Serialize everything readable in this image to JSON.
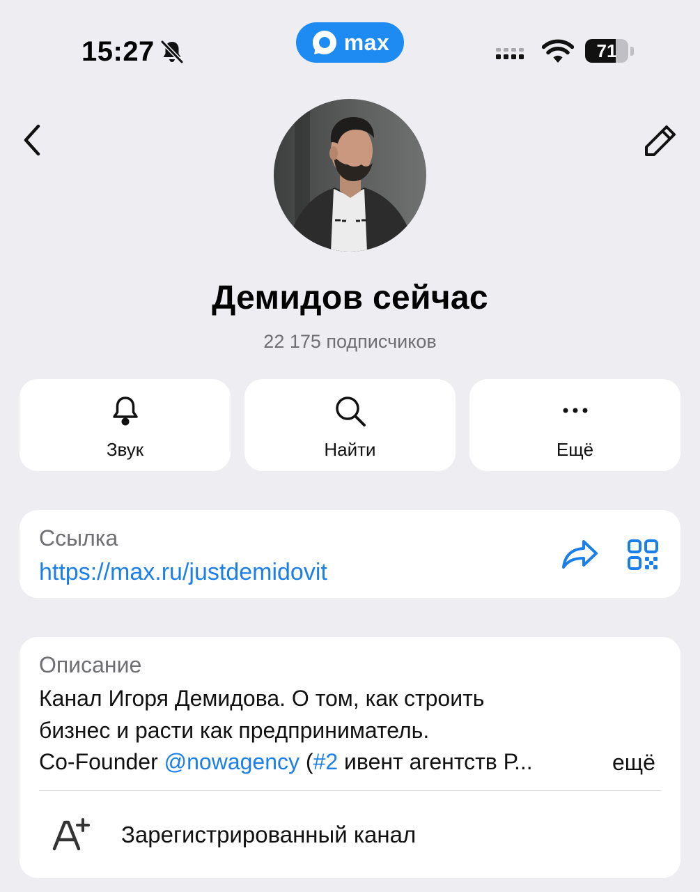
{
  "status_bar": {
    "time": "15:27",
    "battery_level": "71",
    "battery_fraction": 0.71,
    "brand": "max"
  },
  "colors": {
    "background": "#EEEEF2",
    "card": "#FFFFFF",
    "accent": "#1A7FE8",
    "brand": "#1E8BF2",
    "secondary_text": "#6E6E73"
  },
  "icons": {
    "back": "chevron-left-icon",
    "edit": "pencil-icon",
    "sound": "bell-icon",
    "search": "search-icon",
    "more": "ellipsis-icon",
    "share": "share-arrow-icon",
    "qr": "qr-code-icon",
    "registered": "registered-channel-icon"
  },
  "channel": {
    "title": "Демидов сейчас",
    "subscribers": "22 175 подписчиков"
  },
  "actions": [
    {
      "label": "Звук"
    },
    {
      "label": "Найти"
    },
    {
      "label": "Ещё"
    }
  ],
  "link": {
    "caption": "Ссылка",
    "url": "https://max.ru/justdemidovit"
  },
  "description": {
    "caption": "Описание",
    "line1": "Канал Игоря Демидова. О том, как строить",
    "line2": "бизнес и расти как предприниматель.",
    "line3_prefix": "Co-Founder ",
    "mention": "@nowagency",
    "line3_paren": " (",
    "hashtag": "#2",
    "line3_rest": " ивент агентств Р...",
    "more": "ещё"
  },
  "registered": {
    "label": "Зарегистрированный канал"
  }
}
